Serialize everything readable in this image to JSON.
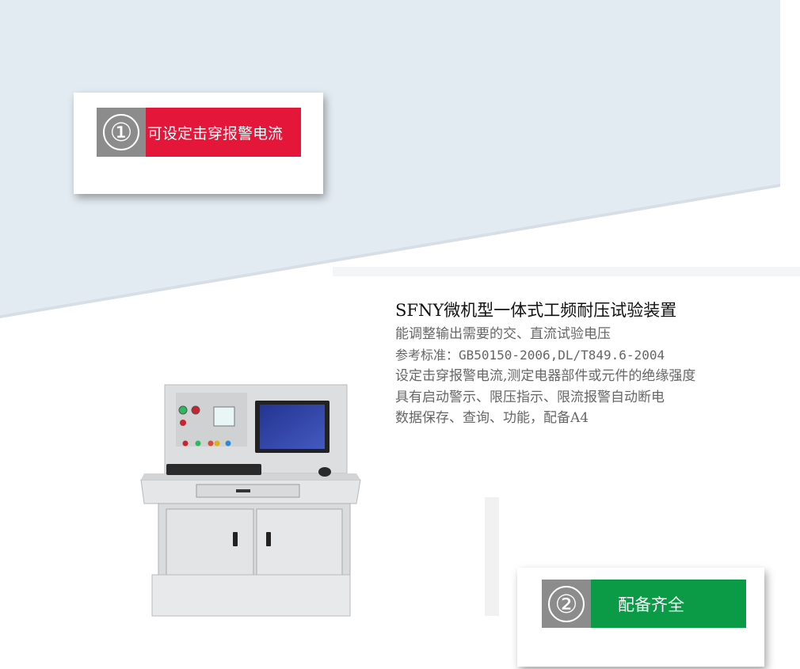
{
  "colors": {
    "band": "#e3ebf2",
    "red": "#e4163a",
    "green": "#0b9b47",
    "gray": "#8c8c8c"
  },
  "badge_1": {
    "number": "①",
    "label": "可设定击穿报警电流"
  },
  "badge_2": {
    "number": "②",
    "label": "配备齐全"
  },
  "product": {
    "title": "SFNY微机型一体式工频耐压试验装置",
    "features": [
      "能调整输出需要的交、直流试验电压",
      "参考标准：GB50150-2006,DL/T849.6-2004",
      "设定击穿报警电流,测定电器部件或元件的绝缘强度",
      "具有启动警示、限压指示、限流报警自动断电",
      "数据保存、查询、功能，配备A4"
    ]
  },
  "image": {
    "icon": "test-console-image"
  }
}
